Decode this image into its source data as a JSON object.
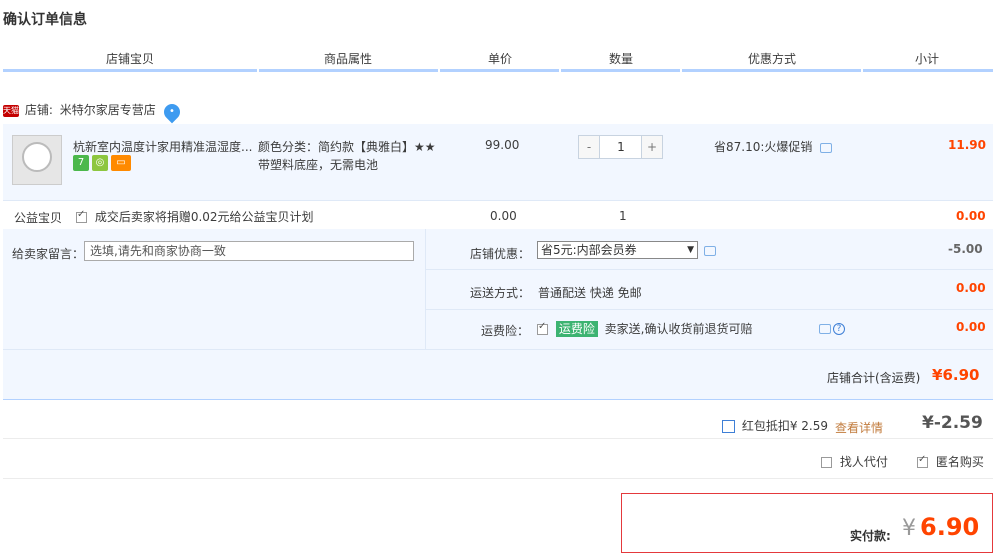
{
  "page": {
    "title": "确认订单信息"
  },
  "columns": [
    "店铺宝贝",
    "商品属性",
    "单价",
    "数量",
    "优惠方式",
    "小计"
  ],
  "shop": {
    "badge": "天猫",
    "label": "店铺:",
    "name": "米特尔家居专营店"
  },
  "item": {
    "title": "杭新室内温度计家用精准温湿度...",
    "attr_line1": "颜色分类：简约款【典雅白】★★",
    "attr_line2": "带塑料底座，无需电池",
    "price": "99.00",
    "quantity": "1",
    "minus": "-",
    "plus": "+",
    "discount": "省87.10:火爆促销",
    "subtotal": "11.90",
    "badge_7": "7"
  },
  "charity": {
    "label": "公益宝贝",
    "text": "成交后卖家将捐赠0.02元给公益宝贝计划",
    "price": "0.00",
    "quantity": "1",
    "subtotal": "0.00"
  },
  "message": {
    "label": "给卖家留言：",
    "placeholder": "选填,请先和商家协商一致"
  },
  "shop_discount": {
    "label": "店铺优惠：",
    "selected": "省5元:内部会员券",
    "amount": "-5.00"
  },
  "shipping": {
    "label": "运送方式：",
    "value": "普通配送 快递 免邮",
    "amount": "0.00"
  },
  "insurance": {
    "label": "运费险：",
    "tag": "运费险",
    "text": "卖家送,确认收货前退货可赔",
    "help": "?",
    "amount": "0.00"
  },
  "shop_total": {
    "label": "店铺合计(含运费)",
    "currency": "¥",
    "amount": "6.90"
  },
  "redpacket": {
    "label": "红包抵扣¥ 2.59",
    "link": "查看详情",
    "currency": "¥",
    "amount": "-2.59"
  },
  "options": {
    "proxy_pay": "找人代付",
    "anonymous": "匿名购买"
  },
  "payment": {
    "label": "实付款:",
    "currency": "¥",
    "amount": "6.90"
  },
  "colors": {
    "accent": "#f40",
    "header_bar": "#b2d1ff",
    "panel_bg": "#f2f7ff",
    "pay_border": "#e4393c"
  }
}
